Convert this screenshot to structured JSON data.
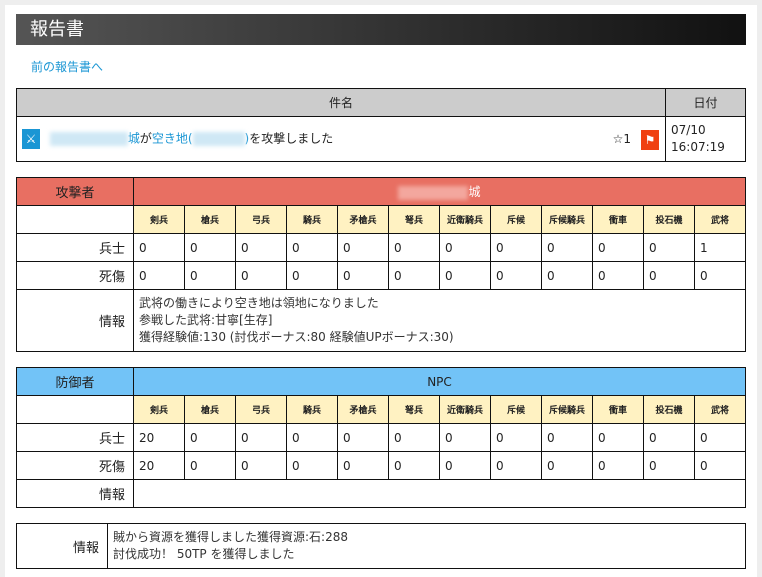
{
  "title": "報告書",
  "prev_link": "前の報告書へ",
  "subject_table": {
    "col_subject": "件名",
    "col_date": "日付",
    "row": {
      "castle_suffix": "城",
      "verb1": "が",
      "target": "空き地(",
      "target_close": ")",
      "verb2": "を攻撃しました",
      "stars": "☆1",
      "date": "07/10",
      "time": "16:07:19"
    }
  },
  "units": [
    "剣兵",
    "槍兵",
    "弓兵",
    "騎兵",
    "矛槍兵",
    "弩兵",
    "近衛騎兵",
    "斥候",
    "斥候騎兵",
    "衝車",
    "投石機",
    "武将"
  ],
  "row_labels": {
    "soldiers": "兵士",
    "casualties": "死傷",
    "info": "情報"
  },
  "attacker": {
    "label": "攻撃者",
    "name_suffix": "城",
    "soldiers": [
      "0",
      "0",
      "0",
      "0",
      "0",
      "0",
      "0",
      "0",
      "0",
      "0",
      "0",
      "1"
    ],
    "casualties": [
      "0",
      "0",
      "0",
      "0",
      "0",
      "0",
      "0",
      "0",
      "0",
      "0",
      "0",
      "0"
    ],
    "info": [
      "武将の働きにより空き地は領地になりました",
      "参戦した武将:甘寧[生存]",
      "獲得経験値:130 (討伐ボーナス:80 経験値UPボーナス:30)"
    ]
  },
  "defender": {
    "label": "防御者",
    "name": "NPC",
    "soldiers": [
      "20",
      "0",
      "0",
      "0",
      "0",
      "0",
      "0",
      "0",
      "0",
      "0",
      "0",
      "0"
    ],
    "casualties": [
      "20",
      "0",
      "0",
      "0",
      "0",
      "0",
      "0",
      "0",
      "0",
      "0",
      "0",
      "0"
    ]
  },
  "result": {
    "label": "情報",
    "lines": [
      "賊から資源を獲得しました獲得資源:石:288",
      "討伐成功！ 50TP を獲得しました"
    ]
  },
  "colors": {
    "attacker": "#e86f62",
    "defender": "#72c3f7",
    "unit_header": "#fff2c2",
    "link": "#1a96d4"
  }
}
